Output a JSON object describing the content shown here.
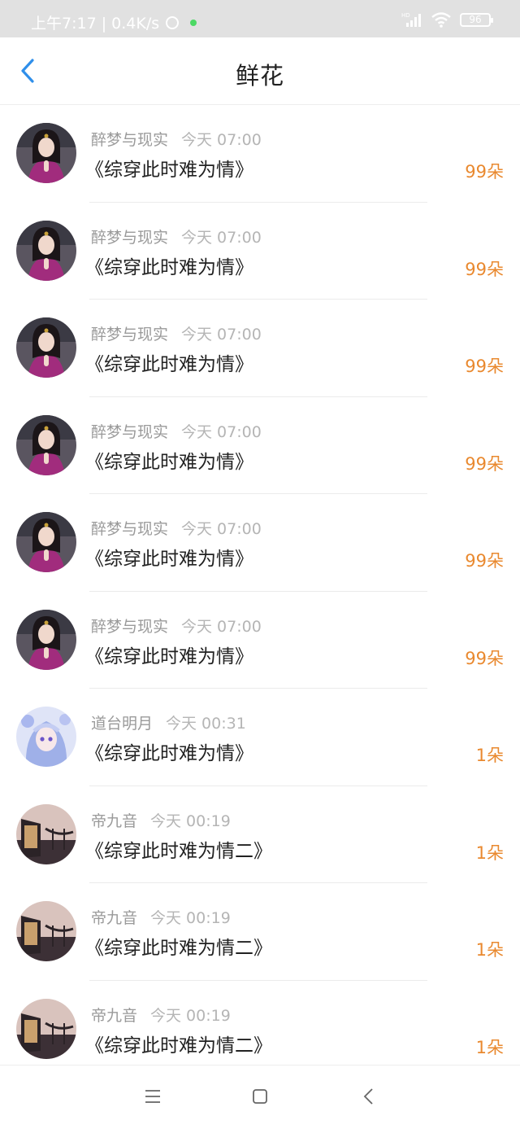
{
  "status_bar": {
    "time_and_speed": "上午7:17 | 0.4K/s",
    "battery": "96",
    "network_label": "HD"
  },
  "header": {
    "title": "鲜花"
  },
  "colors": {
    "accent": "#2f8fea",
    "amount": "#e9892f",
    "name": "#9a9a9a"
  },
  "rows": [
    {
      "name": "醉梦与现实",
      "time": "今天 07:00",
      "book": "《综穿此时难为情》",
      "amount": "99朵",
      "avatar": "girl-portrait"
    },
    {
      "name": "醉梦与现实",
      "time": "今天 07:00",
      "book": "《综穿此时难为情》",
      "amount": "99朵",
      "avatar": "girl-portrait"
    },
    {
      "name": "醉梦与现实",
      "time": "今天 07:00",
      "book": "《综穿此时难为情》",
      "amount": "99朵",
      "avatar": "girl-portrait"
    },
    {
      "name": "醉梦与现实",
      "time": "今天 07:00",
      "book": "《综穿此时难为情》",
      "amount": "99朵",
      "avatar": "girl-portrait"
    },
    {
      "name": "醉梦与现实",
      "time": "今天 07:00",
      "book": "《综穿此时难为情》",
      "amount": "99朵",
      "avatar": "girl-portrait"
    },
    {
      "name": "醉梦与现实",
      "time": "今天 07:00",
      "book": "《综穿此时难为情》",
      "amount": "99朵",
      "avatar": "girl-portrait"
    },
    {
      "name": "道台明月",
      "time": "今天 00:31",
      "book": "《综穿此时难为情》",
      "amount": "1朵",
      "avatar": "anime-portrait"
    },
    {
      "name": "帝九音",
      "time": "今天 00:19",
      "book": "《综穿此时难为情二》",
      "amount": "1朵",
      "avatar": "bridge-scene"
    },
    {
      "name": "帝九音",
      "time": "今天 00:19",
      "book": "《综穿此时难为情二》",
      "amount": "1朵",
      "avatar": "bridge-scene"
    },
    {
      "name": "帝九音",
      "time": "今天 00:19",
      "book": "《综穿此时难为情二》",
      "amount": "1朵",
      "avatar": "bridge-scene"
    }
  ]
}
